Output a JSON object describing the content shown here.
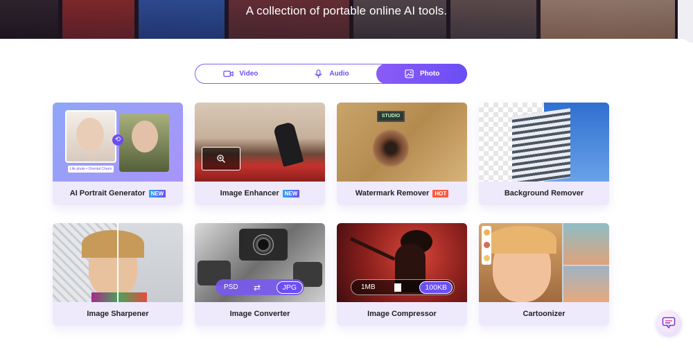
{
  "hero": {
    "title": "A collection of portable online AI tools."
  },
  "tabs": [
    {
      "label": "Video",
      "icon": "video-icon",
      "active": false
    },
    {
      "label": "Audio",
      "icon": "microphone-icon",
      "active": false
    },
    {
      "label": "Photo",
      "icon": "image-icon",
      "active": true
    }
  ],
  "cards": [
    {
      "label": "AI Portrait Generator",
      "badge": "NEW",
      "img_caption_left": "Life photo",
      "img_caption_right": "Oriental Charm"
    },
    {
      "label": "Image Enhancer",
      "badge": "NEW"
    },
    {
      "label": "Watermark Remover",
      "badge": "HOT",
      "sign_text": "STUDIO"
    },
    {
      "label": "Background Remover",
      "badge": ""
    },
    {
      "label": "Image Sharpener",
      "badge": ""
    },
    {
      "label": "Image Converter",
      "badge": "",
      "from": "PSD",
      "to": "JPG"
    },
    {
      "label": "Image Compressor",
      "badge": "",
      "from": "1MB",
      "to": "100KB"
    },
    {
      "label": "Cartoonizer",
      "badge": ""
    }
  ],
  "colors": {
    "accent": "#6d4df2",
    "card_bg": "#eeeafc",
    "hot": "#ff5a3a"
  }
}
